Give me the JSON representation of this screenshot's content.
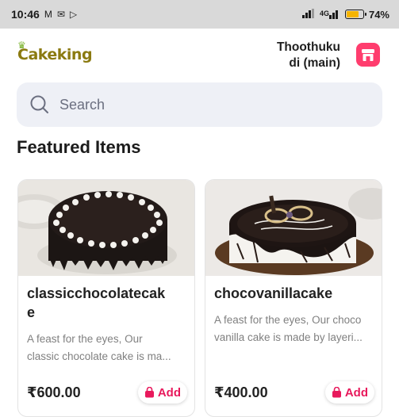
{
  "status_bar": {
    "time": "10:46",
    "left_icons": [
      "gmail-icon",
      "message-icon",
      "play-icon"
    ],
    "battery": "74%",
    "battery_level": 0.74,
    "network": "4G"
  },
  "header": {
    "logo_text": "Cakeking",
    "location_line1": "Thoothuku",
    "location_line2": "di (main)",
    "store_icon": "store-icon"
  },
  "search": {
    "placeholder": "Search"
  },
  "featured": {
    "title": "Featured Items",
    "items": [
      {
        "name": "classicchocolatecake",
        "desc_line1": "A feast for the eyes, Our",
        "desc_line2": "classic chocolate cake is ma...",
        "price": "₹600.00",
        "add_label": "Add"
      },
      {
        "name": "chocovanillacake",
        "desc_line1": "A feast for the eyes, Our choco",
        "desc_line2": "vanilla cake is made by layeri...",
        "price": "₹400.00",
        "add_label": "Add"
      }
    ]
  },
  "colors": {
    "accent": "#e8195c",
    "store_button": "#ff3d6e",
    "search_bg": "#eef0f6",
    "info_badge": "#6d7490"
  }
}
